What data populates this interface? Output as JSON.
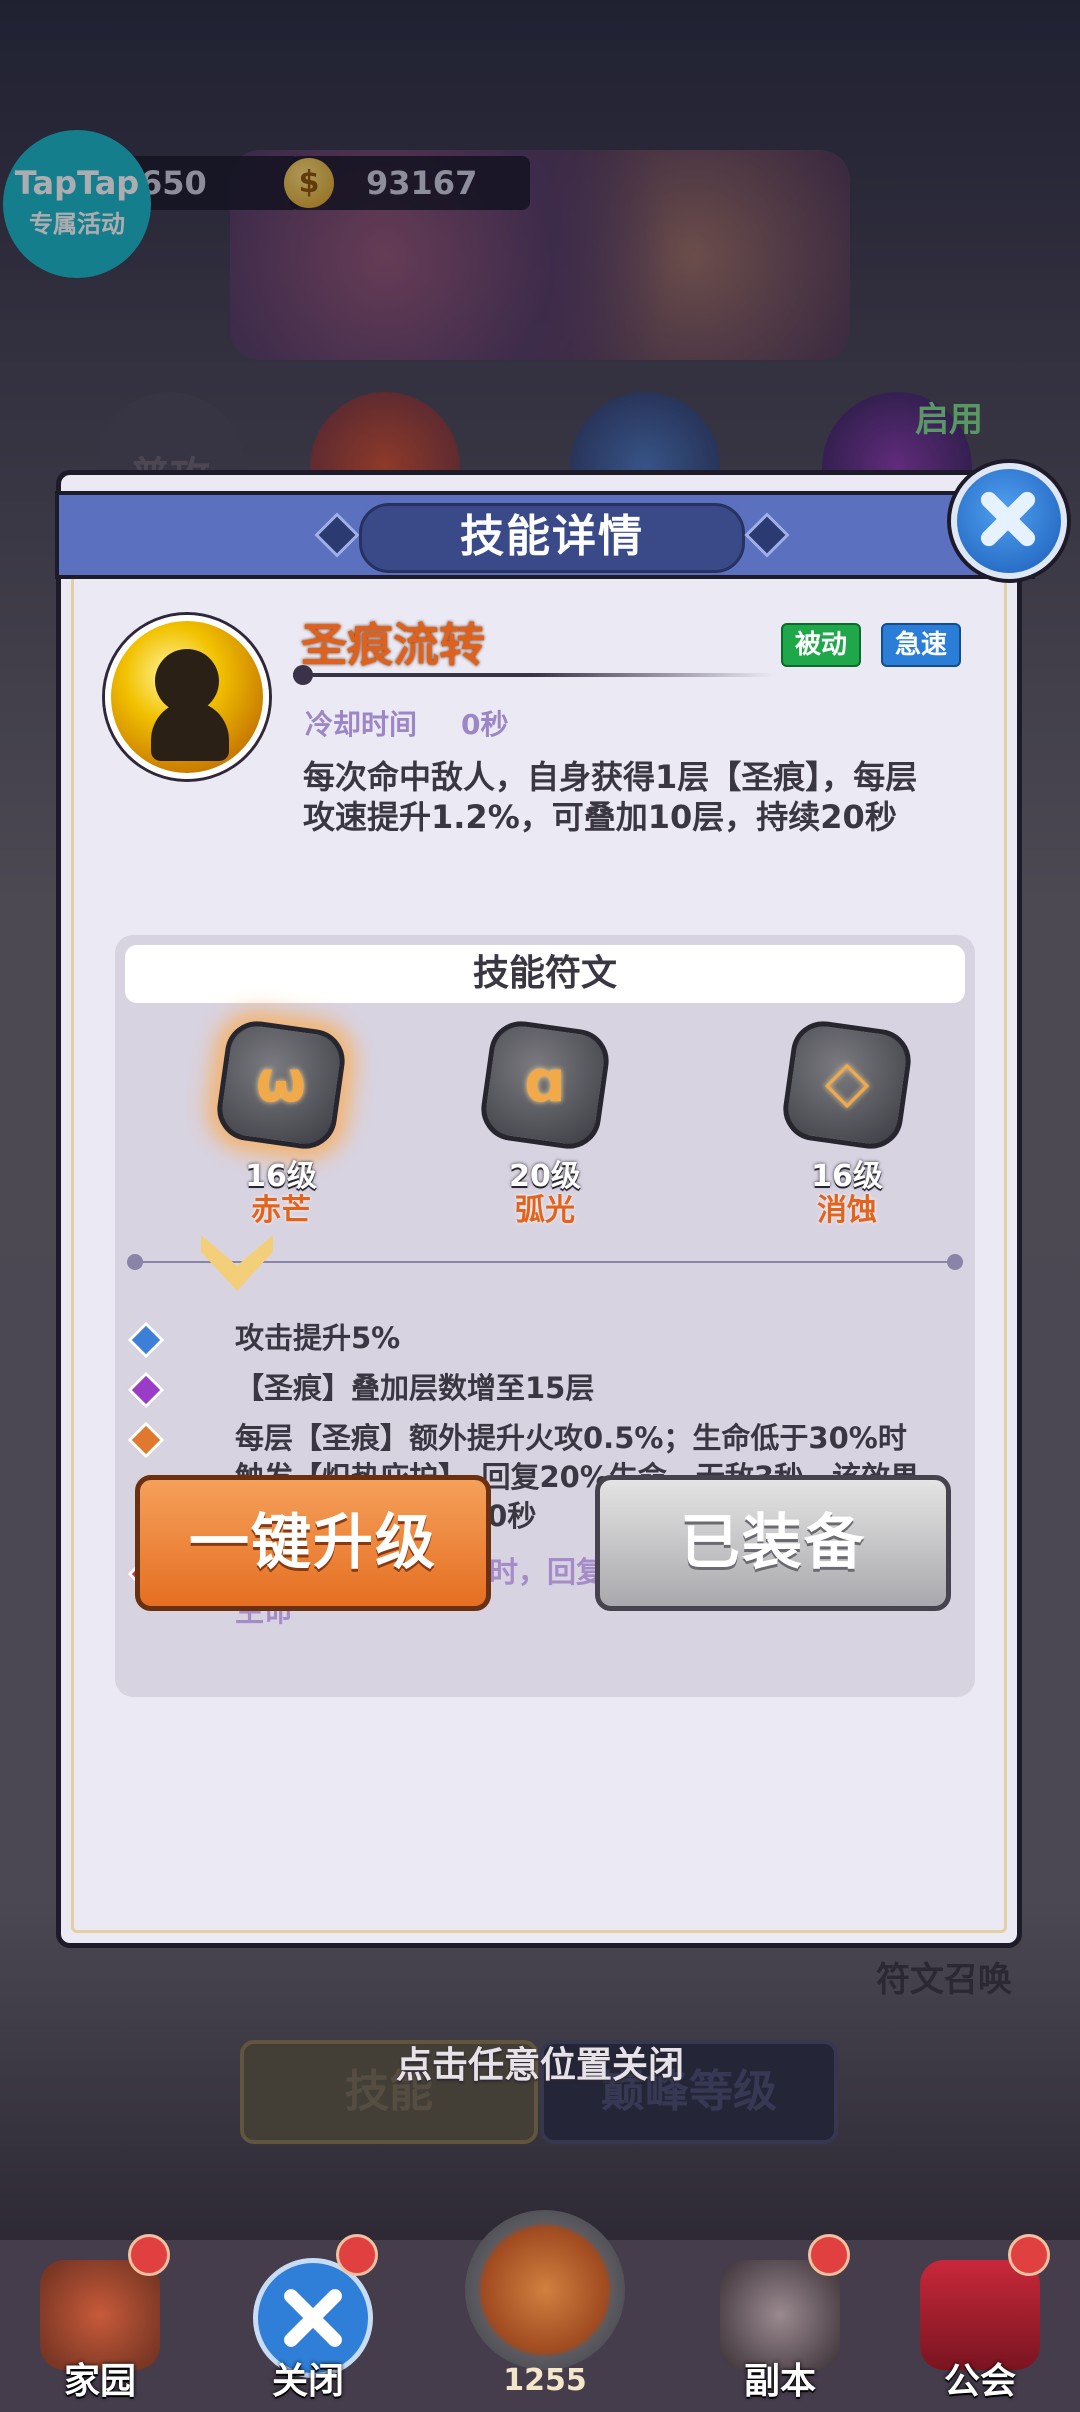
{
  "background": {
    "resource1_value": "650",
    "resource2_value": "93167",
    "coin_symbol": "$",
    "taptap_title": "TapTap",
    "taptap_subtitle": "专属活动",
    "skill_tab_label": "普攻",
    "enabled_label": "启用",
    "rune_summon_label": "符文召唤",
    "tab_skill": "技能",
    "tab_peak_level": "巅峰等级",
    "close_hint": "点击任意位置关闭"
  },
  "bottom_nav": {
    "items": [
      {
        "label": "家园"
      },
      {
        "label": "关闭"
      },
      {
        "label": "1255"
      },
      {
        "label": "副本"
      },
      {
        "label": "公会"
      }
    ]
  },
  "modal": {
    "title": "技能详情",
    "skill_name": "圣痕流转",
    "tags": {
      "passive": "被动",
      "haste": "急速"
    },
    "cooldown_label": "冷却时间",
    "cooldown_value": "0秒",
    "description": "每次命中敌人，自身获得1层【圣痕】，每层攻速提升1.2%，可叠加10层，持续20秒",
    "rune_section_title": "技能符文",
    "runes": [
      {
        "glyph": "ω",
        "level": "16级",
        "name": "赤芒"
      },
      {
        "glyph": "ɑ",
        "level": "20级",
        "name": "弧光"
      },
      {
        "glyph": "◇",
        "level": "16级",
        "name": "消蚀"
      }
    ],
    "effects": [
      {
        "text": "攻击提升5%",
        "color": "#3d7fd8"
      },
      {
        "text": "【圣痕】叠加层数增至15层",
        "color": "#9a3cc8"
      },
      {
        "text": "每层【圣痕】额外提升火攻0.5%；生命低于30%时触发【炽热庇护】，回复20%生命，无敌3秒，该效果的效果冷却时长为30秒",
        "color": "#e0782e"
      },
      {
        "text": "触发【炽热庇护】时，回复友方生命最低目标20%生命",
        "color": "#d8303a"
      }
    ],
    "upgrade_button": "一键升级",
    "equipped_button": "已装备"
  }
}
